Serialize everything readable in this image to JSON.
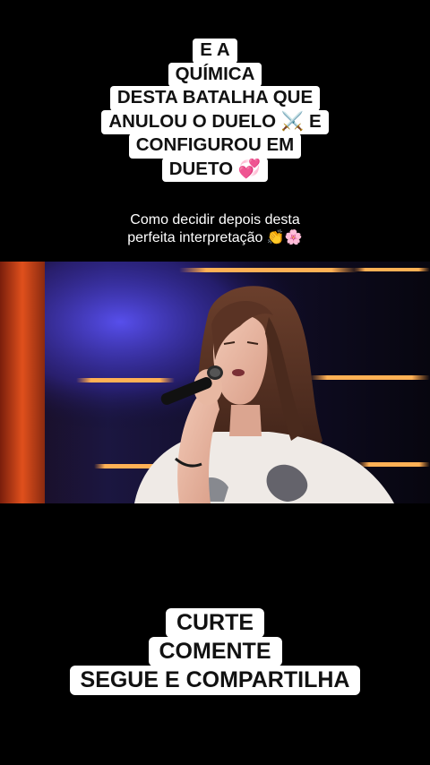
{
  "top_caption": {
    "lines": [
      "E A",
      "QUÍMICA",
      "DESTA BATALHA QUE",
      "ANULOU O DUELO ⚔️ E",
      "CONFIGUROU EM",
      "DUETO 💞"
    ]
  },
  "subtitle": {
    "lines": [
      "Como decidir depois desta",
      "perfeita interpretação 👏🌸"
    ]
  },
  "video": {
    "scene": "singer-with-microphone-on-stage"
  },
  "bottom_caption": {
    "lines": [
      "CURTE",
      "COMENTE",
      "SEGUE E COMPARTILHA"
    ]
  },
  "colors": {
    "background": "#000000",
    "caption_bg": "#ffffff",
    "caption_text": "#111111",
    "stage_light": "#ff9a3c",
    "stage_blue": "#4a3cff"
  }
}
